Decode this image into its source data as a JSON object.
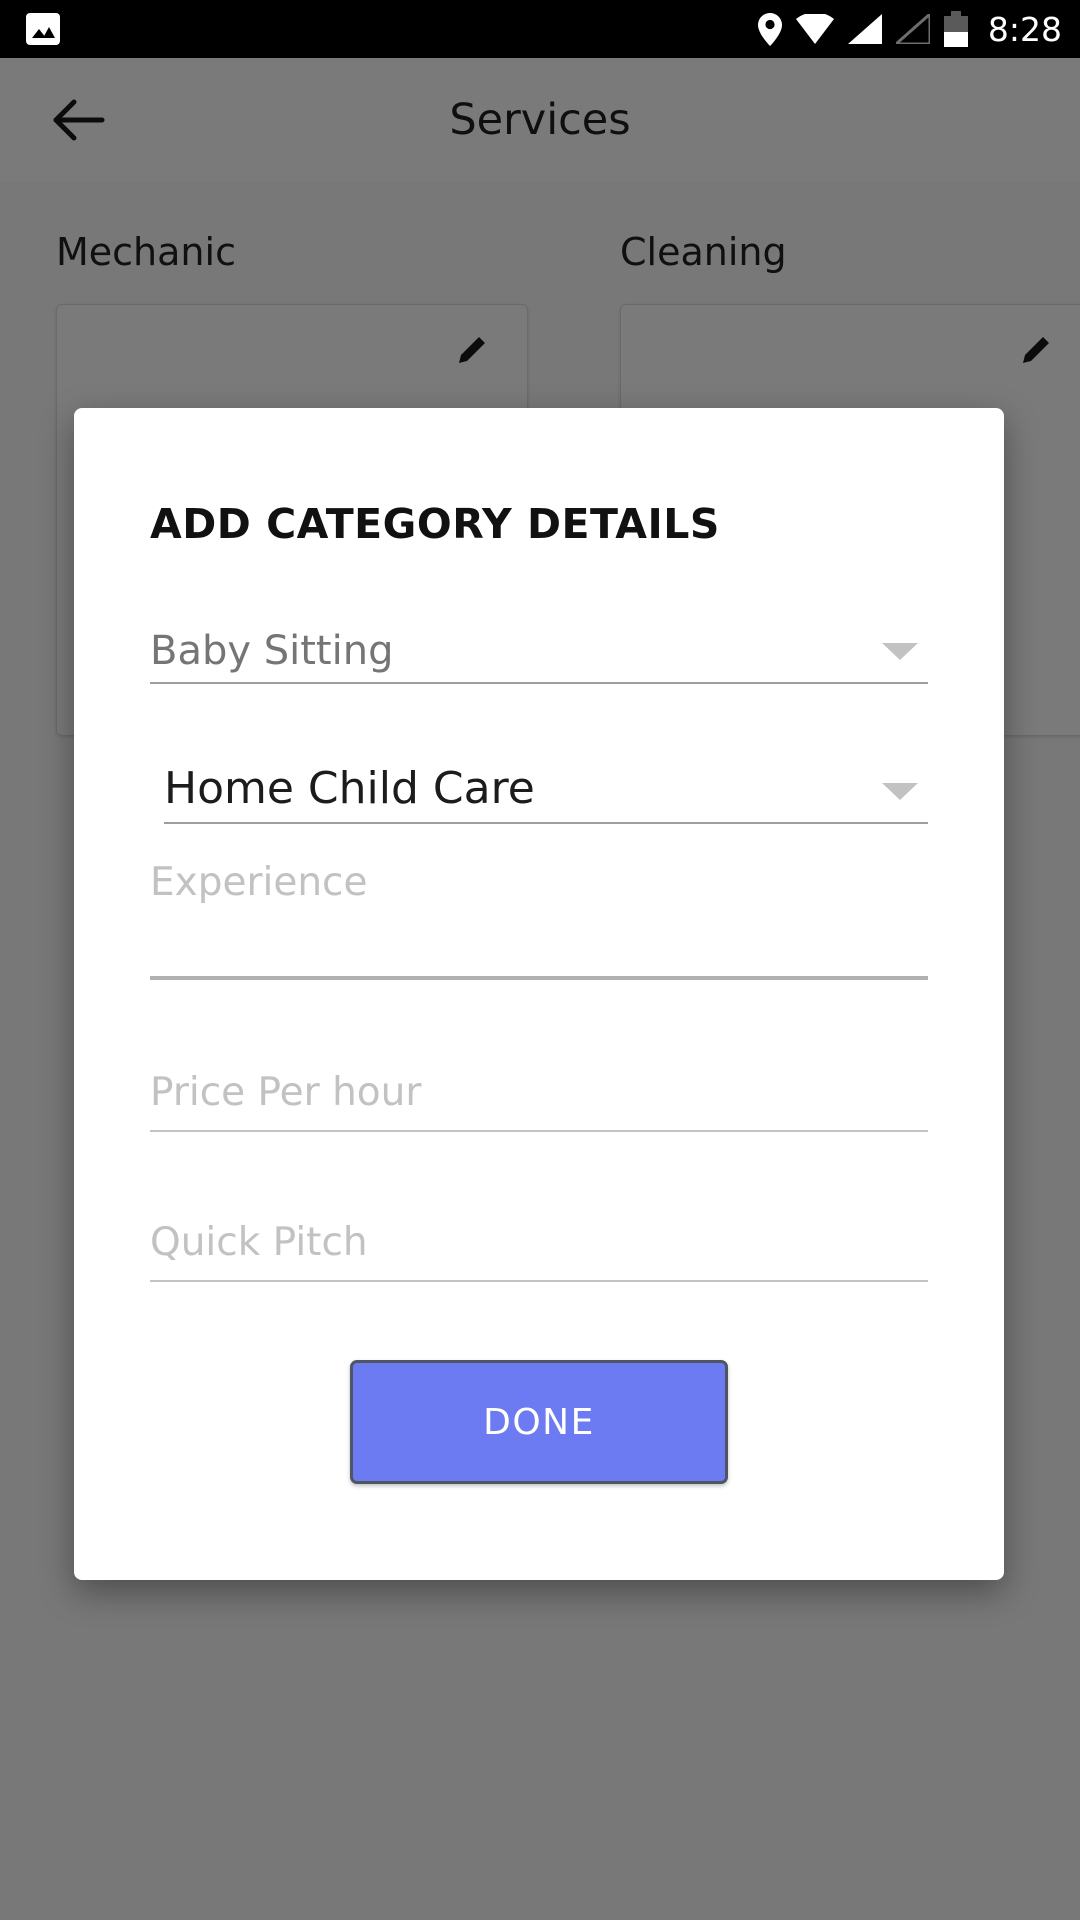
{
  "status_bar": {
    "time": "8:28",
    "icons": [
      "photo-icon",
      "location-pin-icon",
      "wifi-icon",
      "signal-full-icon",
      "signal-empty-icon",
      "battery-icon"
    ],
    "background_color": "#000000",
    "battery_level_percent": 50
  },
  "app_bar": {
    "title": "Services",
    "back_icon": "back-arrow-icon"
  },
  "background_screen": {
    "categories": [
      {
        "title": "Mechanic",
        "card_icon": "pencil-icon"
      },
      {
        "title": "Cleaning",
        "card_icon": "pencil-icon"
      }
    ]
  },
  "dialog": {
    "title": "ADD CATEGORY DETAILS",
    "category_select": {
      "value": "Baby Sitting",
      "caret_icon": "chevron-down-icon"
    },
    "subcategory_select": {
      "value": "Home Child Care",
      "caret_icon": "chevron-down-icon"
    },
    "experience_field": {
      "placeholder": "Experience",
      "value": ""
    },
    "price_field": {
      "placeholder": "Price Per hour",
      "value": ""
    },
    "pitch_field": {
      "placeholder": "Quick Pitch",
      "value": ""
    },
    "done_button": {
      "label": "DONE",
      "background_color": "#6D7BF2",
      "border_color": "#4E5661",
      "text_color": "#FFFFFF"
    }
  }
}
